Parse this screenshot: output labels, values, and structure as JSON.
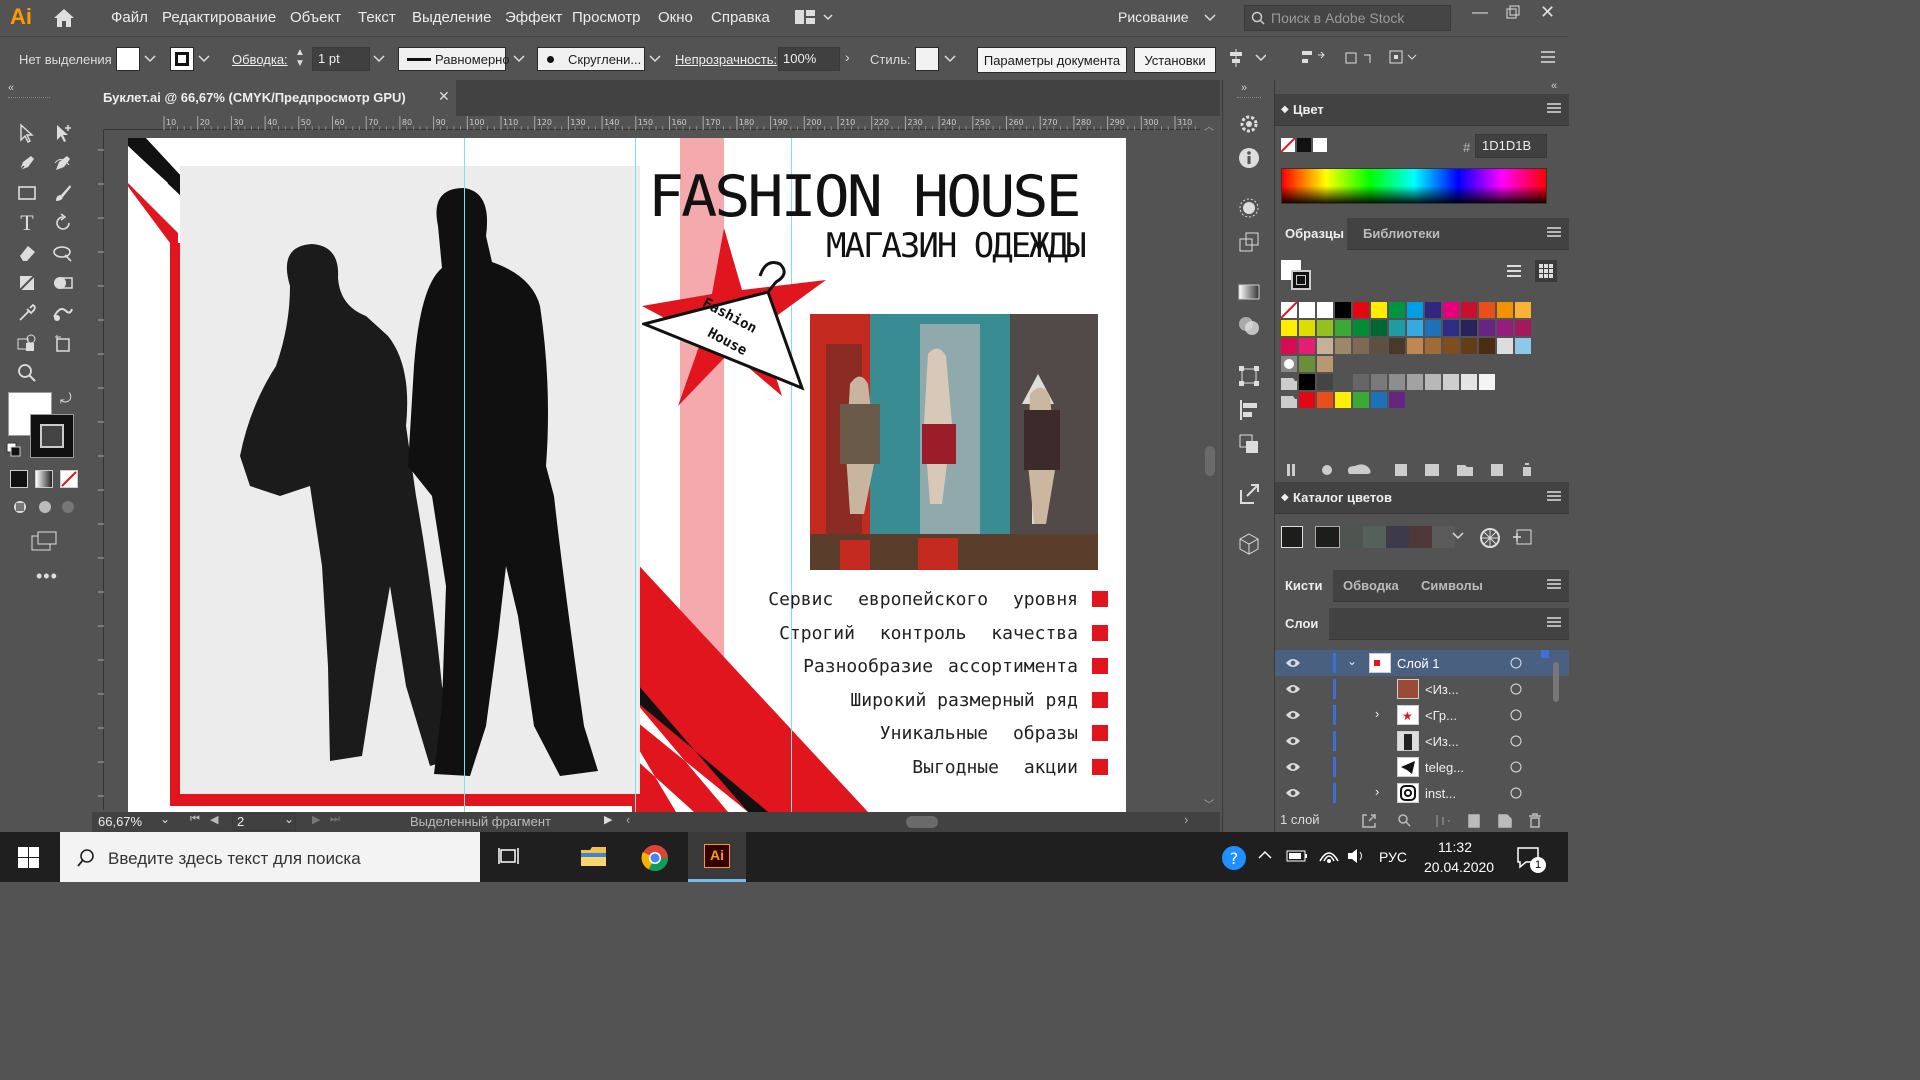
{
  "app": {
    "logo": "Ai",
    "workspace": "Рисование",
    "stock_search_placeholder": "Поиск в Adobe Stock"
  },
  "menu": [
    "Файл",
    "Редактирование",
    "Объект",
    "Текст",
    "Выделение",
    "Эффект",
    "Просмотр",
    "Окно",
    "Справка"
  ],
  "control": {
    "selection": "Нет выделения",
    "stroke_label": "Обводка:",
    "stroke_value": "1 pt",
    "stroke_profile": "Равномерно",
    "brush": "Скруглени...",
    "opacity_label": "Непрозрачность:",
    "opacity_value": "100%",
    "style_label": "Стиль:",
    "doc_settings": "Параметры документа",
    "prefs": "Установки"
  },
  "doc_tab": {
    "title": "Буклет.ai @ 66,67% (CMYK/Предпросмотр GPU)"
  },
  "ruler_ticks": [
    "10",
    "20",
    "30",
    "40",
    "50",
    "60",
    "70",
    "80",
    "90",
    "100",
    "110",
    "120",
    "130",
    "140",
    "150",
    "160",
    "170",
    "180",
    "190",
    "200",
    "210",
    "220",
    "230",
    "240",
    "250",
    "260",
    "270",
    "280",
    "290",
    "300",
    "310"
  ],
  "brochure": {
    "title": "FASHION HOUSE",
    "subtitle": "МАГАЗИН ОДЕЖДЫ",
    "hanger_line1": "Fashion",
    "hanger_line2": "House",
    "features": [
      "Сервис европейского уровня",
      "Строгий контроль качества",
      "Разнообразие ассортимента",
      "Широкий размерный ряд",
      "Уникальные образы",
      "Выгодные акции"
    ],
    "colors": {
      "red": "#e0151d",
      "pink": "#f4a9ad",
      "black": "#111111"
    }
  },
  "status": {
    "zoom": "66,67%",
    "artboard": "2",
    "info": "Выделенный фрагмент"
  },
  "color_panel": {
    "title": "Цвет",
    "hex": "1D1D1B"
  },
  "swatches_tabs": [
    "Образцы",
    "Библиотеки"
  ],
  "color_guide": {
    "title": "Каталог цветов"
  },
  "brush_tabs": [
    "Кисти",
    "Обводка",
    "Символы"
  ],
  "layers": {
    "title": "Слои",
    "rows": [
      "Слой 1",
      "<Из...",
      "<Гр...",
      "<Из...",
      "teleg...",
      "inst..."
    ],
    "footer": "1 слой"
  },
  "taskbar": {
    "search_placeholder": "Введите здесь текст для поиска",
    "lang": "РУС",
    "time": "11:32",
    "date": "20.04.2020",
    "notif": "1"
  }
}
